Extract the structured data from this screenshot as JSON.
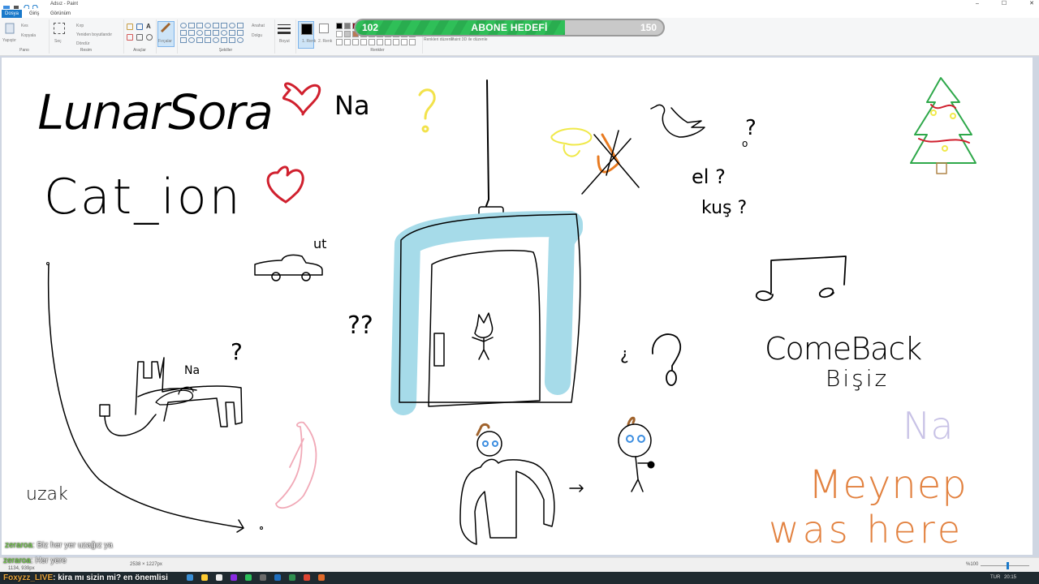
{
  "window": {
    "title": "Adsız - Paint",
    "controls": [
      "–",
      "☐",
      "✕"
    ]
  },
  "tabs": [
    {
      "label": "Dosya",
      "active": true
    },
    {
      "label": "Giriş",
      "active": false
    },
    {
      "label": "Görünüm",
      "active": false
    }
  ],
  "ribbon": {
    "pano": {
      "label": "Pano",
      "paste": "Yapıştır",
      "cut": "Kes",
      "copy": "Kopyala"
    },
    "resim": {
      "label": "Resim",
      "select": "Seç",
      "crop": "Kırp",
      "resize": "Yeniden boyutlandır",
      "rotate": "Döndür"
    },
    "araclar": {
      "label": "Araçlar"
    },
    "fircalar": {
      "label": "Fırçalar"
    },
    "sekiller": {
      "label": "Şekiller",
      "outline": "Anahat",
      "fill": "Dolgu"
    },
    "boyut": {
      "label": "Boyut"
    },
    "renk1": {
      "label": "1. Renk"
    },
    "renk2": {
      "label": "2. Renk"
    },
    "edit_colors": "Renkleri düzenle",
    "paint3d": "Paint 3D ile düzenle",
    "renkler": {
      "label": "Renkler"
    }
  },
  "goal": {
    "label": "ABONE HEDEFİ",
    "current": "102",
    "target": "150",
    "progress": 0.68,
    "fill_color": "#2fbf58"
  },
  "drawing_texts": {
    "lunarsora": "LunarSora",
    "na1": "Na",
    "cation": "Cat_ion",
    "el": "el ?",
    "kus": "kuş ?",
    "comeback": "ComeBack",
    "bisiz": "Bişiz",
    "na_purple": "Na",
    "meynep": "Meynep",
    "was_here": "was here",
    "na_bed": "Na",
    "ut": "ut",
    "uzak": "uzak"
  },
  "chat": [
    {
      "user": "zeraroa",
      "message": ": Biz her yer uzağız ya"
    },
    {
      "user": "zeraroa",
      "message": ": Her yere"
    }
  ],
  "statusbar": {
    "cursor": "1134, 939px",
    "size": "2538 × 1227px",
    "zoom": "%100"
  },
  "ticker": {
    "user": "Foxyzz_LIVE",
    "message": ": kira mı sizin mi? en önemlisi"
  },
  "taskbar": {
    "lang": "TUR",
    "time": "20:15"
  },
  "colors": {
    "accent": "#1979ca",
    "sky_blue": "#a6dbe9",
    "heart_red": "#d0202e",
    "meynep_orange": "#e2813f",
    "na_purple": "#c8c2e6",
    "tree_green": "#2ea84a",
    "banana_pink": "#f1a9b7"
  }
}
